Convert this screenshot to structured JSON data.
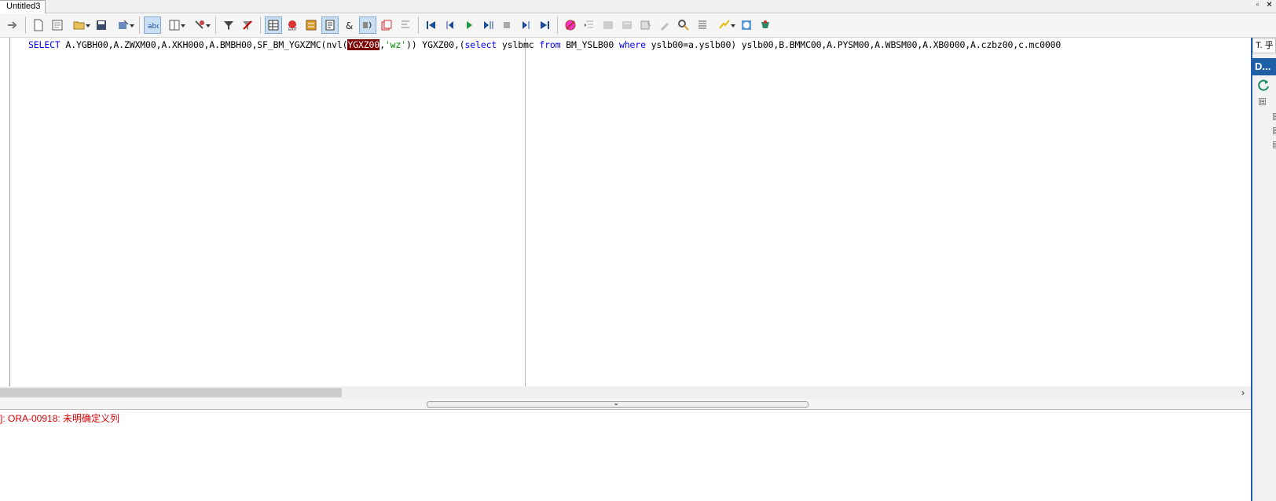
{
  "tabs": [
    {
      "label": "Untitled3"
    }
  ],
  "window_controls": {
    "restore": "▫",
    "close": "✕"
  },
  "toolbar": {
    "buttons": [
      {
        "name": "execute-arrow-icon",
        "active": false
      },
      {
        "name": "new-file-icon",
        "active": false
      },
      {
        "name": "new-window-icon",
        "active": false
      },
      {
        "name": "open-folder-icon",
        "active": false,
        "dropdown": true
      },
      {
        "name": "save-icon",
        "active": false
      },
      {
        "name": "save-as-icon",
        "active": false,
        "dropdown": true
      },
      {
        "name": "autocomplete-icon",
        "active": true
      },
      {
        "name": "layout-icon",
        "active": false,
        "dropdown": true
      },
      {
        "name": "tools-icon",
        "active": false,
        "dropdown": true
      },
      {
        "name": "filter-icon",
        "active": false
      },
      {
        "name": "clear-filter-icon",
        "active": false
      },
      {
        "name": "grid-icon",
        "active": true
      },
      {
        "name": "cancel-icon",
        "active": false
      },
      {
        "name": "explain-icon",
        "active": false
      },
      {
        "name": "query-builder-icon",
        "active": true
      },
      {
        "name": "ampersand-icon",
        "active": false,
        "glyph": "&"
      },
      {
        "name": "bind-variable-icon",
        "active": true
      },
      {
        "name": "copy-icon",
        "active": false
      },
      {
        "name": "format-icon",
        "active": false
      },
      {
        "name": "first-icon",
        "active": false
      },
      {
        "name": "previous-icon",
        "active": false
      },
      {
        "name": "play-icon",
        "active": false
      },
      {
        "name": "step-icon",
        "active": false
      },
      {
        "name": "stop-icon",
        "active": false
      },
      {
        "name": "next-icon",
        "active": false
      },
      {
        "name": "last-icon",
        "active": false
      },
      {
        "name": "debug-icon",
        "active": false
      },
      {
        "name": "indent-icon",
        "active": false
      },
      {
        "name": "comment-icon",
        "active": false
      },
      {
        "name": "uncomment-icon",
        "active": false
      },
      {
        "name": "compile-icon",
        "active": false
      },
      {
        "name": "edit-icon",
        "active": false
      },
      {
        "name": "find-icon",
        "active": false
      },
      {
        "name": "list-icon",
        "active": false
      },
      {
        "name": "highlight-icon",
        "active": false,
        "dropdown": true
      },
      {
        "name": "help-icon",
        "active": false
      },
      {
        "name": "connect-icon",
        "active": false
      }
    ]
  },
  "editor": {
    "sql_tokens": [
      {
        "t": "SELECT",
        "c": "kw"
      },
      {
        "t": " A.YGBH00,A.ZWXM00,A.XKH000,A.BMBH00,SF_BM_YGXZMC(nvl(",
        "c": ""
      },
      {
        "t": "YGXZ00",
        "c": "sel"
      },
      {
        "t": ",",
        "c": ""
      },
      {
        "t": "'wz'",
        "c": "str"
      },
      {
        "t": ")) YGXZ00,(",
        "c": ""
      },
      {
        "t": "select",
        "c": "kw"
      },
      {
        "t": " yslbmc ",
        "c": ""
      },
      {
        "t": "from",
        "c": "kw"
      },
      {
        "t": " BM_YSLB00 ",
        "c": ""
      },
      {
        "t": "where",
        "c": "kw"
      },
      {
        "t": " yslb00=a.yslb00) yslb00,B.BMMC00,A.PYSM00,A.WBSM00,A.XB0000,A.czbz00,c.mc0000",
        "c": ""
      }
    ]
  },
  "scrollbar": {
    "right_arrow": "›"
  },
  "splitter": {
    "arrow": "⌄"
  },
  "output": {
    "error_text": "]: ORA-00918: 未明确定义列"
  },
  "right_panel": {
    "tab_label": "T. 乎",
    "header_label": "D...",
    "tree_boxes": [
      "⊟",
      "⊞",
      "⊞",
      "⊞"
    ]
  }
}
